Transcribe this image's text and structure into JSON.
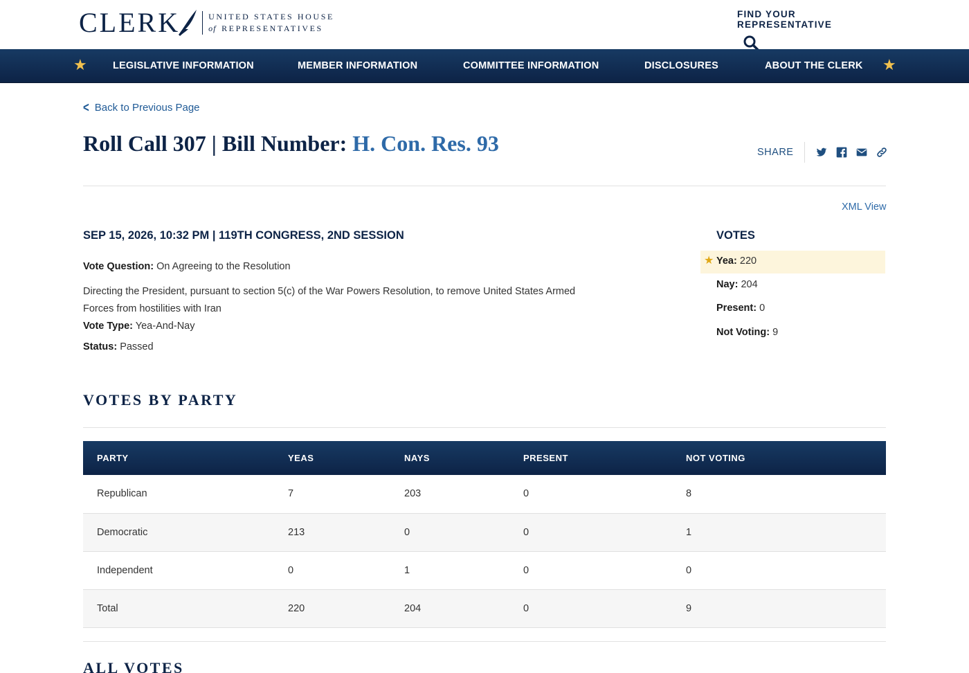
{
  "header": {
    "logo_word": "CLERK",
    "logo_line1": "UNITED STATES HOUSE",
    "logo_of": "of",
    "logo_line2": "REPRESENTATIVES",
    "find_rep_label": "FIND YOUR REPRESENTATIVE",
    "star_color": "#f2c14e",
    "nav_color": "#0d2346"
  },
  "nav": {
    "items": [
      {
        "label": "LEGISLATIVE INFORMATION"
      },
      {
        "label": "MEMBER INFORMATION"
      },
      {
        "label": "COMMITTEE INFORMATION"
      },
      {
        "label": "DISCLOSURES"
      },
      {
        "label": "ABOUT THE CLERK"
      }
    ]
  },
  "page": {
    "back_label": "Back to Previous Page",
    "title_prefix": "Roll Call 307 | Bill Number: ",
    "bill_number": "H. Con. Res. 93",
    "share_label": "SHARE",
    "share_icons": [
      "twitter-icon",
      "facebook-icon",
      "email-icon",
      "link-icon"
    ],
    "xml_view": "XML View",
    "date_line": "SEP 15, 2026, 10:32 PM | 119TH CONGRESS, 2ND SESSION",
    "vote_question_label": "Vote Question:",
    "vote_question": "On Agreeing to the Resolution",
    "description": "Directing the President, pursuant to section 5(c) of the War Powers Resolution, to remove United States Armed Forces from hostilities with Iran",
    "vote_type_label": "Vote Type:",
    "vote_type": "Yea-And-Nay",
    "status_label": "Status:",
    "status": "Passed"
  },
  "votes": {
    "heading": "VOTES",
    "rows": [
      {
        "label": "Yea:",
        "value": "220",
        "winner": true
      },
      {
        "label": "Nay:",
        "value": "204"
      },
      {
        "label": "Present:",
        "value": "0"
      },
      {
        "label": "Not Voting:",
        "value": "9"
      }
    ]
  },
  "party_table": {
    "section_title": "VOTES BY PARTY",
    "headers": [
      "PARTY",
      "YEAS",
      "NAYS",
      "PRESENT",
      "NOT VOTING"
    ],
    "rows": [
      [
        "Republican",
        "7",
        "203",
        "0",
        "8"
      ],
      [
        "Democratic",
        "213",
        "0",
        "0",
        "1"
      ],
      [
        "Independent",
        "0",
        "1",
        "0",
        "0"
      ],
      [
        "Total",
        "220",
        "204",
        "0",
        "9"
      ]
    ]
  },
  "all_votes": {
    "section_title": "ALL VOTES"
  }
}
